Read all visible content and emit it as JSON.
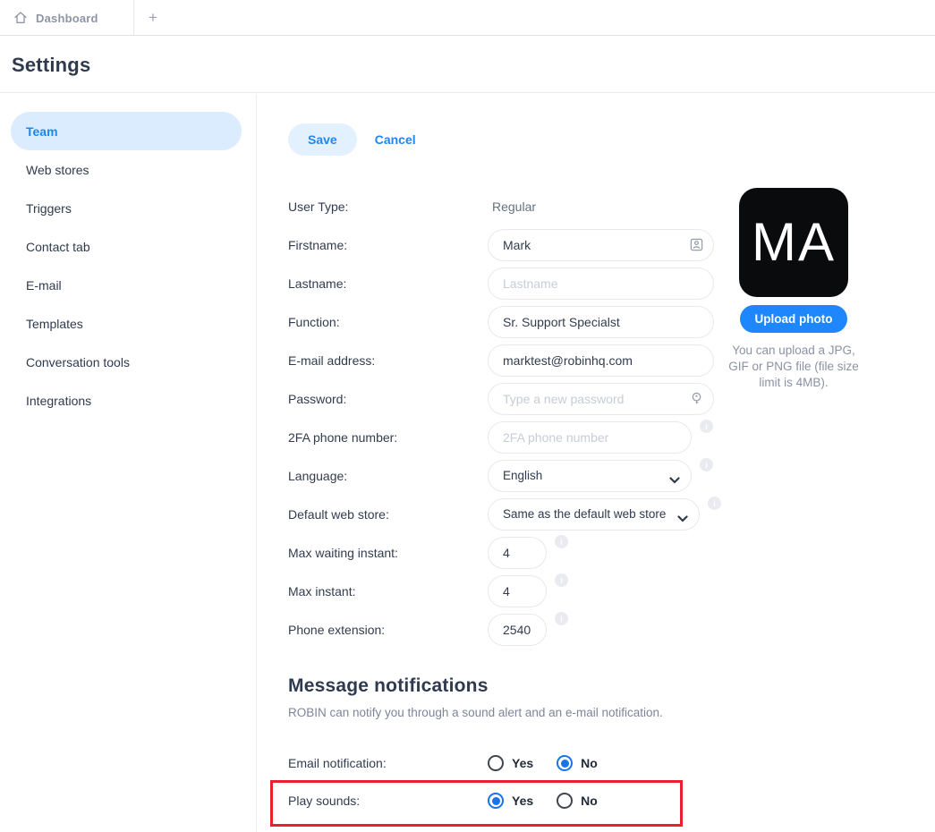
{
  "window": {
    "tab_label": "Dashboard",
    "new_tab_label": "+"
  },
  "header": {
    "title": "Settings"
  },
  "sidebar": {
    "items": [
      {
        "label": "Team",
        "active": true
      },
      {
        "label": "Web stores",
        "active": false
      },
      {
        "label": "Triggers",
        "active": false
      },
      {
        "label": "Contact tab",
        "active": false
      },
      {
        "label": "E-mail",
        "active": false
      },
      {
        "label": "Templates",
        "active": false
      },
      {
        "label": "Conversation tools",
        "active": false
      },
      {
        "label": "Integrations",
        "active": false
      }
    ]
  },
  "toolbar": {
    "save_label": "Save",
    "cancel_label": "Cancel"
  },
  "form": {
    "rows": [
      {
        "label": "User Type:",
        "value": "Regular"
      },
      {
        "label": "Firstname:",
        "value": "Mark"
      },
      {
        "label": "Lastname:",
        "placeholder": "Lastname"
      },
      {
        "label": "Function:",
        "value": "Sr. Support Specialst"
      },
      {
        "label": "E-mail address:",
        "value": "marktest@robinhq.com"
      },
      {
        "label": "Password:",
        "placeholder": "Type a new password"
      },
      {
        "label": "2FA phone number:",
        "placeholder": "2FA phone number"
      },
      {
        "label": "Language:",
        "value": "English"
      },
      {
        "label": "Default web store:",
        "value": "Same as the default web store"
      },
      {
        "label": "Max waiting instant:",
        "value": "4"
      },
      {
        "label": "Max instant:",
        "value": "4"
      },
      {
        "label": "Phone extension:",
        "value": "2540"
      }
    ],
    "info_icon_glyph": "i"
  },
  "avatar": {
    "initials": "MA",
    "upload_label": "Upload photo",
    "note": "You can upload a JPG, GIF or PNG file (file size limit is 4MB)."
  },
  "notifications": {
    "title": "Message notifications",
    "description": "ROBIN can notify you through a sound alert and an e-mail notification.",
    "rows": [
      {
        "label": "Email notification:",
        "yes": "Yes",
        "no": "No",
        "selected": "No"
      },
      {
        "label": "Play sounds:",
        "yes": "Yes",
        "no": "No",
        "selected": "Yes"
      }
    ]
  },
  "colors": {
    "accent_blue": "#1e87f0",
    "radio_selected_blue": "#1a73e8",
    "highlight_red": "#e8212b",
    "heading_navy": "#2f3a4f",
    "sidebar_active_bg": "#daecfe"
  }
}
